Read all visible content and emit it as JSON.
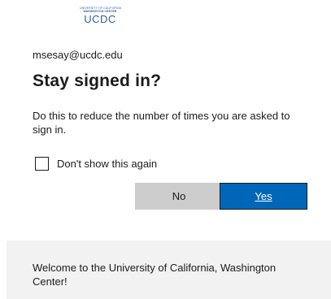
{
  "logo": {
    "line1": "UNIVERSITY OF CALIFORNIA",
    "line2": "WASHINGTON CENTER",
    "main": "UCDC"
  },
  "account": "msesay@ucdc.edu",
  "title": "Stay signed in?",
  "description": "Do this to reduce the number of times you are asked to sign in.",
  "checkbox": {
    "label": "Don't show this again",
    "checked": false
  },
  "buttons": {
    "no": "No",
    "yes": "Yes"
  },
  "colors": {
    "primary": "#0067b8",
    "secondary": "#cccccc",
    "footer_bg": "#f2f2f2"
  },
  "footer": {
    "text": "Welcome to the University of California, Washington Center!"
  }
}
